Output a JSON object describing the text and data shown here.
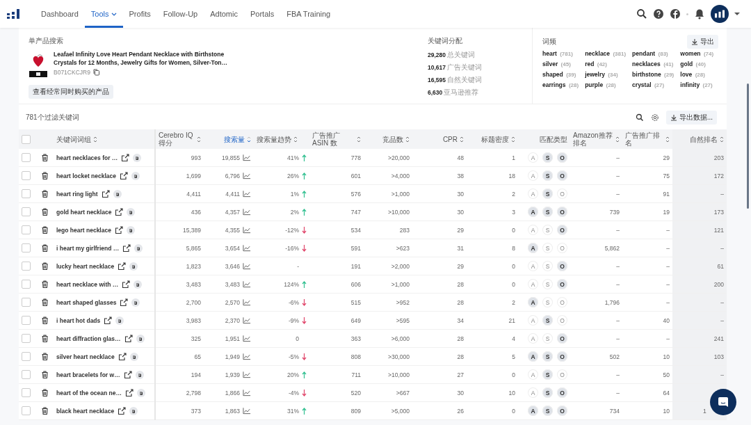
{
  "nav": {
    "items": [
      {
        "label": "Dashboard",
        "selected": false
      },
      {
        "label": "Tools",
        "selected": true,
        "dropdown": true
      },
      {
        "label": "Profits",
        "selected": false
      },
      {
        "label": "Follow-Up",
        "selected": false
      },
      {
        "label": "Adtomic",
        "selected": false
      },
      {
        "label": "Portals",
        "selected": false
      },
      {
        "label": "FBA Training",
        "selected": false
      }
    ]
  },
  "product": {
    "heading": "单产品搜索",
    "title": "Leafael Infinity Love Heart Pendant Necklace with Birthstone Crystals for 12 Months, Jewelry Gifts for Women, Silver-Ton…",
    "asin": "B071CKCJR9",
    "button": "查看经常同时购买的产品"
  },
  "distribution": {
    "heading": "关键词分配",
    "rows": [
      {
        "value": "29,280",
        "label": "总关键词"
      },
      {
        "value": "10,617",
        "label": "广告关键词"
      },
      {
        "value": "16,595",
        "label": "自然关键词"
      },
      {
        "value": "6,630",
        "label": "亚马逊推荐"
      }
    ]
  },
  "word_frequency": {
    "heading": "词频",
    "export": "导出",
    "words": [
      {
        "word": "heart",
        "count": "(781)"
      },
      {
        "word": "necklace",
        "count": "(381)"
      },
      {
        "word": "pendant",
        "count": "(83)"
      },
      {
        "word": "women",
        "count": "(74)"
      },
      {
        "word": "silver",
        "count": "(45)"
      },
      {
        "word": "red",
        "count": "(42)"
      },
      {
        "word": "necklaces",
        "count": "(41)"
      },
      {
        "word": "gold",
        "count": "(40)"
      },
      {
        "word": "shaped",
        "count": "(39)"
      },
      {
        "word": "jewelry",
        "count": "(34)"
      },
      {
        "word": "birthstone",
        "count": "(29)"
      },
      {
        "word": "love",
        "count": "(28)"
      },
      {
        "word": "earrings",
        "count": "(28)"
      },
      {
        "word": "purple",
        "count": "(28)"
      },
      {
        "word": "crystal",
        "count": "(27)"
      },
      {
        "word": "infinity",
        "count": "(27)"
      }
    ]
  },
  "table": {
    "count_label": "781个过滤关键词",
    "select_all_checked": false,
    "export": "导出数据...",
    "columns": [
      {
        "label": "关键词词组",
        "sortable": true,
        "selected": false
      },
      {
        "label": "Cerebro IQ 得分",
        "sortable": true,
        "selected": false
      },
      {
        "label": "搜索量",
        "sortable": true,
        "selected": true
      },
      {
        "label": "搜索量趋势",
        "sortable": true,
        "selected": false
      },
      {
        "label": "广告推广 ASIN 数",
        "sortable": true,
        "selected": false
      },
      {
        "label": "竞品数",
        "sortable": true,
        "selected": false
      },
      {
        "label": "CPR",
        "sortable": true,
        "selected": false
      },
      {
        "label": "标题密度",
        "sortable": true,
        "selected": false
      },
      {
        "label": "匹配类型",
        "sortable": false,
        "selected": false
      },
      {
        "label": "Amazon推荐排名",
        "sortable": true,
        "selected": false
      },
      {
        "label": "广告推广排名",
        "sortable": true,
        "selected": false
      },
      {
        "label": "自然排名",
        "sortable": true,
        "selected": false
      }
    ],
    "rows": [
      {
        "keyword": "heart necklaces for …",
        "checked": false,
        "iq": "993",
        "volume": "19,855",
        "trend": "41%",
        "kind": "rising",
        "asins": "778",
        "competitors": ">20,000",
        "cpr": "48",
        "density": "1",
        "match": [
          {
            "label": "A",
            "on": false
          },
          {
            "label": "S",
            "on": true
          },
          {
            "label": "O",
            "on": true
          }
        ],
        "amazon_rank": "–",
        "ad_rank": "29",
        "organic_rank": "203"
      },
      {
        "keyword": "heart locket necklace",
        "checked": false,
        "iq": "1,699",
        "volume": "6,796",
        "trend": "26%",
        "kind": "rising",
        "asins": "601",
        "competitors": ">4,000",
        "cpr": "38",
        "density": "18",
        "match": [
          {
            "label": "A",
            "on": false
          },
          {
            "label": "S",
            "on": true
          },
          {
            "label": "O",
            "on": true
          }
        ],
        "amazon_rank": "–",
        "ad_rank": "75",
        "organic_rank": "172"
      },
      {
        "keyword": "heart ring light",
        "checked": false,
        "iq": "4,411",
        "volume": "4,411",
        "trend": "1%",
        "kind": "rising",
        "asins": "576",
        "competitors": ">1,000",
        "cpr": "30",
        "density": "2",
        "match": [
          {
            "label": "A",
            "on": false
          },
          {
            "label": "S",
            "on": true
          },
          {
            "label": "O",
            "on": false
          }
        ],
        "amazon_rank": "–",
        "ad_rank": "91",
        "organic_rank": "–"
      },
      {
        "keyword": "gold heart necklace",
        "checked": false,
        "iq": "436",
        "volume": "4,357",
        "trend": "2%",
        "kind": "rising",
        "asins": "747",
        "competitors": ">10,000",
        "cpr": "30",
        "density": "3",
        "match": [
          {
            "label": "A",
            "on": true
          },
          {
            "label": "S",
            "on": true
          },
          {
            "label": "O",
            "on": true
          }
        ],
        "amazon_rank": "739",
        "ad_rank": "19",
        "organic_rank": "173"
      },
      {
        "keyword": "lego heart necklace",
        "checked": false,
        "iq": "15,389",
        "volume": "4,355",
        "trend": "-12%",
        "kind": "falling",
        "asins": "534",
        "competitors": "283",
        "cpr": "29",
        "density": "0",
        "match": [
          {
            "label": "A",
            "on": false
          },
          {
            "label": "S",
            "on": false
          },
          {
            "label": "O",
            "on": true
          }
        ],
        "amazon_rank": "–",
        "ad_rank": "–",
        "organic_rank": "121"
      },
      {
        "keyword": "i heart my girlfriend …",
        "checked": false,
        "iq": "5,865",
        "volume": "3,654",
        "trend": "-16%",
        "kind": "falling",
        "asins": "591",
        "competitors": ">623",
        "cpr": "31",
        "density": "8",
        "match": [
          {
            "label": "A",
            "on": true
          },
          {
            "label": "S",
            "on": false
          },
          {
            "label": "O",
            "on": false
          }
        ],
        "amazon_rank": "5,862",
        "ad_rank": "–",
        "organic_rank": "–"
      },
      {
        "keyword": "lucky heart necklace",
        "checked": false,
        "iq": "1,823",
        "volume": "3,646",
        "trend": "-",
        "kind": "flat",
        "asins": "191",
        "competitors": ">2,000",
        "cpr": "29",
        "density": "0",
        "match": [
          {
            "label": "A",
            "on": false
          },
          {
            "label": "S",
            "on": false
          },
          {
            "label": "O",
            "on": true
          }
        ],
        "amazon_rank": "–",
        "ad_rank": "–",
        "organic_rank": "61"
      },
      {
        "keyword": "heart necklace with …",
        "checked": false,
        "iq": "3,483",
        "volume": "3,483",
        "trend": "124%",
        "kind": "rising",
        "asins": "606",
        "competitors": ">1,000",
        "cpr": "28",
        "density": "0",
        "match": [
          {
            "label": "A",
            "on": false
          },
          {
            "label": "S",
            "on": false
          },
          {
            "label": "O",
            "on": true
          }
        ],
        "amazon_rank": "–",
        "ad_rank": "–",
        "organic_rank": "200"
      },
      {
        "keyword": "heart shaped glasses",
        "checked": false,
        "iq": "2,700",
        "volume": "2,570",
        "trend": "-6%",
        "kind": "falling",
        "asins": "515",
        "competitors": ">952",
        "cpr": "28",
        "density": "2",
        "match": [
          {
            "label": "A",
            "on": true
          },
          {
            "label": "S",
            "on": false
          },
          {
            "label": "O",
            "on": false
          }
        ],
        "amazon_rank": "1,796",
        "ad_rank": "–",
        "organic_rank": "–"
      },
      {
        "keyword": "i heart hot dads",
        "checked": false,
        "iq": "3,983",
        "volume": "2,370",
        "trend": "-9%",
        "kind": "falling",
        "asins": "649",
        "competitors": ">595",
        "cpr": "34",
        "density": "21",
        "match": [
          {
            "label": "A",
            "on": false
          },
          {
            "label": "S",
            "on": true
          },
          {
            "label": "O",
            "on": false
          }
        ],
        "amazon_rank": "–",
        "ad_rank": "40",
        "organic_rank": "–"
      },
      {
        "keyword": "heart diffraction glas…",
        "checked": false,
        "iq": "325",
        "volume": "1,951",
        "trend": "0",
        "kind": "flat",
        "asins": "363",
        "competitors": ">6,000",
        "cpr": "28",
        "density": "4",
        "match": [
          {
            "label": "A",
            "on": false
          },
          {
            "label": "S",
            "on": false
          },
          {
            "label": "O",
            "on": true
          }
        ],
        "amazon_rank": "–",
        "ad_rank": "–",
        "organic_rank": "241"
      },
      {
        "keyword": "silver heart necklace",
        "checked": false,
        "iq": "65",
        "volume": "1,949",
        "trend": "-5%",
        "kind": "falling",
        "asins": "808",
        "competitors": ">30,000",
        "cpr": "28",
        "density": "5",
        "match": [
          {
            "label": "A",
            "on": true
          },
          {
            "label": "S",
            "on": true
          },
          {
            "label": "O",
            "on": true
          }
        ],
        "amazon_rank": "502",
        "ad_rank": "10",
        "organic_rank": "103"
      },
      {
        "keyword": "heart bracelets for w…",
        "checked": false,
        "iq": "194",
        "volume": "1,939",
        "trend": "20%",
        "kind": "rising",
        "asins": "711",
        "competitors": ">10,000",
        "cpr": "27",
        "density": "0",
        "match": [
          {
            "label": "A",
            "on": false
          },
          {
            "label": "S",
            "on": true
          },
          {
            "label": "O",
            "on": false
          }
        ],
        "amazon_rank": "–",
        "ad_rank": "50",
        "organic_rank": "–"
      },
      {
        "keyword": "heart of the ocean ne…",
        "checked": false,
        "iq": "2,798",
        "volume": "1,866",
        "trend": "-4%",
        "kind": "falling",
        "asins": "520",
        "competitors": ">667",
        "cpr": "30",
        "density": "10",
        "match": [
          {
            "label": "A",
            "on": false
          },
          {
            "label": "S",
            "on": true
          },
          {
            "label": "O",
            "on": true
          }
        ],
        "amazon_rank": "–",
        "ad_rank": "64"
      },
      {
        "keyword": "black heart necklace",
        "checked": false,
        "iq": "373",
        "volume": "1,863",
        "trend": "31%",
        "kind": "rising",
        "asins": "809",
        "competitors": ">5,000",
        "cpr": "26",
        "density": "0",
        "match": [
          {
            "label": "A",
            "on": true
          },
          {
            "label": "S",
            "on": true
          },
          {
            "label": "O",
            "on": true
          }
        ],
        "amazon_rank": "734",
        "ad_rank": "10",
        "organic_rank": "1",
        "under_overlay": true
      }
    ]
  }
}
